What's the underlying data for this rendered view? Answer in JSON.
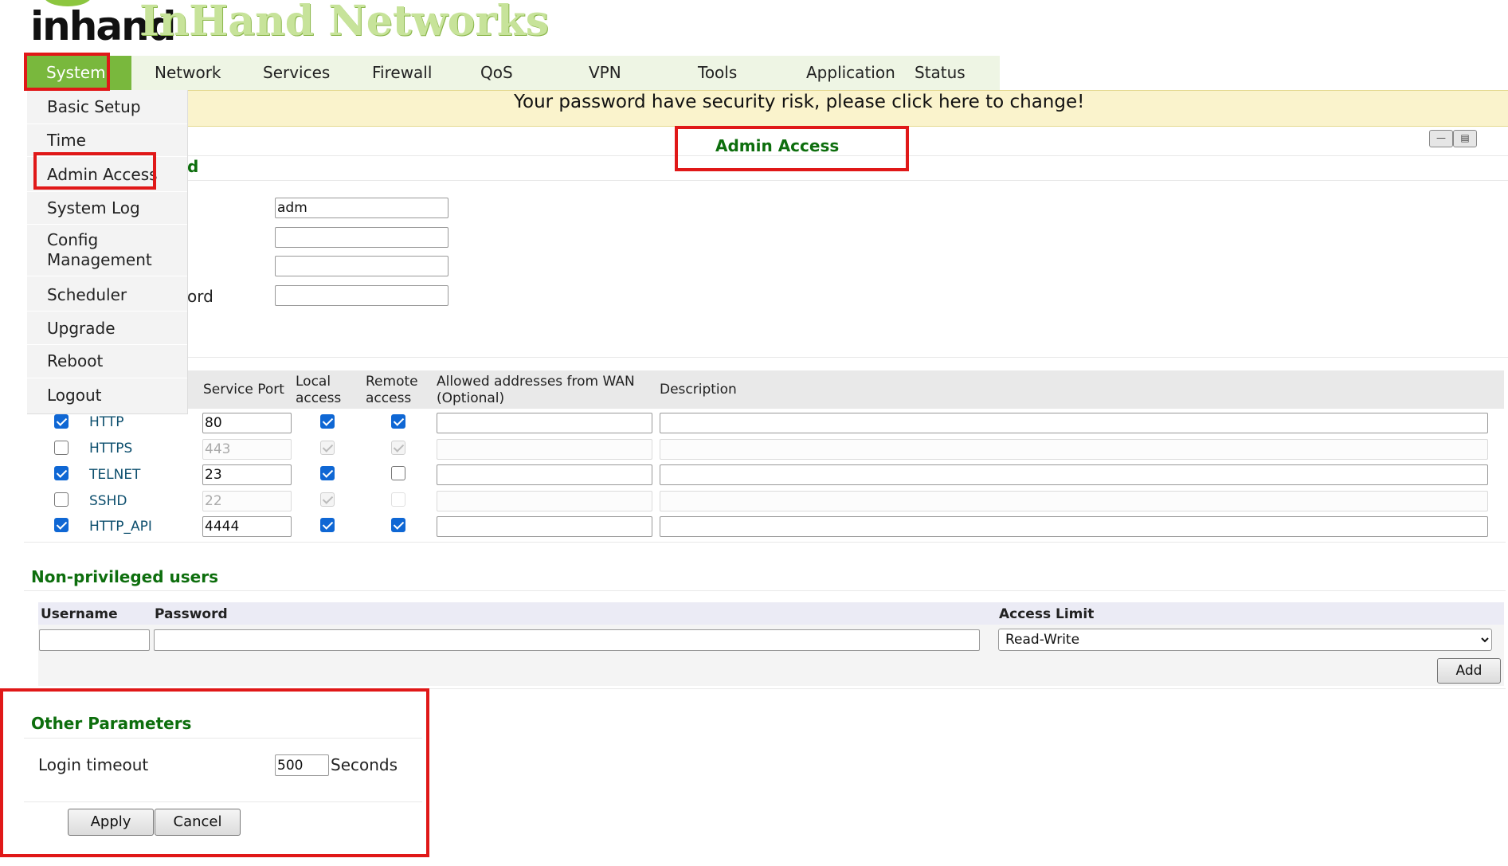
{
  "brand": {
    "logo_text": "inhand",
    "title": "InHand Networks"
  },
  "nav": {
    "items": [
      "System",
      "Network",
      "Services",
      "Firewall",
      "QoS",
      "VPN",
      "Tools",
      "Application",
      "Status"
    ]
  },
  "system_menu": {
    "items": [
      "Basic Setup",
      "Time",
      "Admin Access",
      "System Log",
      "Config Management",
      "Scheduler",
      "Upgrade",
      "Reboot",
      "Logout"
    ]
  },
  "banner": {
    "text": "Your password have security risk, please click here to change!"
  },
  "page": {
    "title": "Admin Access",
    "window_buttons": [
      "minimize-icon",
      "restore-icon"
    ]
  },
  "user_section": {
    "heading_fragment": "d",
    "confirm_label_fragment": "ord",
    "fields": [
      {
        "value": "adm"
      },
      {
        "value": ""
      },
      {
        "value": ""
      },
      {
        "value": ""
      }
    ]
  },
  "services": {
    "headers": {
      "port": "Service Port",
      "local": "Local access",
      "remote": "Remote access",
      "allowed": "Allowed addresses from WAN (Optional)",
      "description": "Description"
    },
    "rows": [
      {
        "enabled": true,
        "name": "HTTP",
        "port": "80",
        "local": true,
        "remote": true,
        "allowed": "",
        "description": ""
      },
      {
        "enabled": false,
        "name": "HTTPS",
        "port": "443",
        "local": true,
        "remote": true,
        "allowed": "",
        "description": ""
      },
      {
        "enabled": true,
        "name": "TELNET",
        "port": "23",
        "local": true,
        "remote": false,
        "allowed": "",
        "description": ""
      },
      {
        "enabled": false,
        "name": "SSHD",
        "port": "22",
        "local": true,
        "remote": false,
        "allowed": "",
        "description": ""
      },
      {
        "enabled": true,
        "name": "HTTP_API",
        "port": "4444",
        "local": true,
        "remote": true,
        "allowed": "",
        "description": ""
      }
    ]
  },
  "non_privileged": {
    "heading": "Non-privileged users",
    "headers": {
      "username": "Username",
      "password": "Password",
      "access_limit": "Access Limit"
    },
    "username": "",
    "password": "",
    "access_limit": "Read-Write",
    "add_label": "Add"
  },
  "other_params": {
    "heading": "Other Parameters",
    "login_timeout_label": "Login timeout",
    "login_timeout_value": "500",
    "unit": "Seconds"
  },
  "actions": {
    "apply": "Apply",
    "cancel": "Cancel"
  },
  "colors": {
    "accent_green": "#79b83d",
    "heading_green": "#0d6e0d",
    "highlight_red": "#e01818",
    "banner_yellow": "#faf3cc",
    "checkbox_blue": "#0f67d4"
  }
}
